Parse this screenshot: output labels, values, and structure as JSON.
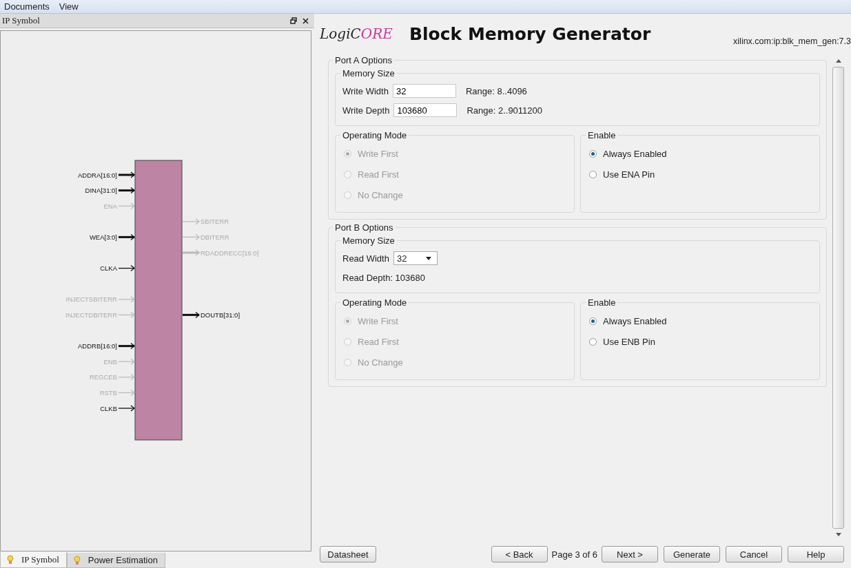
{
  "menu": [
    {
      "label": "Documents"
    },
    {
      "label": "View"
    }
  ],
  "symbol_panel": {
    "title": "IP Symbol",
    "rows": [
      {
        "left": {
          "name": "ADDRA[16:0]",
          "enabled": true,
          "bus": true
        }
      },
      {
        "left": {
          "name": "DINA[31:0]",
          "enabled": true,
          "bus": true
        }
      },
      {
        "left": {
          "name": "ENA",
          "enabled": false,
          "bus": false
        }
      },
      {
        "right": {
          "name": "SBITERR",
          "enabled": false,
          "bus": false
        }
      },
      {
        "left": {
          "name": "WEA[3:0]",
          "enabled": true,
          "bus": true
        },
        "right": {
          "name": "DBITERR",
          "enabled": false,
          "bus": false
        }
      },
      {
        "right": {
          "name": "RDADDRECC[16:0]",
          "enabled": false,
          "bus": true
        }
      },
      {
        "left": {
          "name": "CLKA",
          "enabled": true,
          "bus": false
        }
      },
      {},
      {
        "left": {
          "name": "INJECTSBITERR",
          "enabled": false,
          "bus": false
        }
      },
      {
        "left": {
          "name": "INJECTDBITERR",
          "enabled": false,
          "bus": false
        },
        "right": {
          "name": "DOUTB[31:0]",
          "enabled": true,
          "bus": true
        }
      },
      {},
      {
        "left": {
          "name": "ADDRB[16:0]",
          "enabled": true,
          "bus": true
        }
      },
      {
        "left": {
          "name": "ENB",
          "enabled": false,
          "bus": false
        }
      },
      {
        "left": {
          "name": "REGCEB",
          "enabled": false,
          "bus": false
        }
      },
      {
        "left": {
          "name": "RSTB",
          "enabled": false,
          "bus": false
        }
      },
      {
        "left": {
          "name": "CLKB",
          "enabled": true,
          "bus": false
        }
      }
    ]
  },
  "bottom_tabs": [
    {
      "label": "IP Symbol",
      "selected": true
    },
    {
      "label": "Power Estimation",
      "selected": false
    }
  ],
  "header": {
    "logo": "LogiCORE",
    "title": "Block Memory Generator",
    "ip_id": "xilinx.com:ip:blk_mem_gen:7.3"
  },
  "ports": [
    {
      "title": "Port A Options",
      "memory_size": {
        "title": "Memory Size",
        "fields": [
          {
            "kind": "input",
            "label": "Write Width",
            "value": "32",
            "range": "Range: 8..4096"
          },
          {
            "kind": "input",
            "label": "Write Depth",
            "value": "103680",
            "range": "Range: 2..9011200"
          }
        ]
      },
      "operating_mode": {
        "title": "Operating Mode",
        "options": [
          {
            "label": "Write First",
            "selected": true,
            "disabled": true
          },
          {
            "label": "Read First",
            "selected": false,
            "disabled": true
          },
          {
            "label": "No Change",
            "selected": false,
            "disabled": true
          }
        ]
      },
      "enable": {
        "title": "Enable",
        "options": [
          {
            "label": "Always Enabled",
            "selected": true,
            "disabled": false
          },
          {
            "label": "Use ENA Pin",
            "selected": false,
            "disabled": false
          }
        ]
      }
    },
    {
      "title": "Port B Options",
      "memory_size": {
        "title": "Memory Size",
        "fields": [
          {
            "kind": "dropdown",
            "label": "Read Width",
            "value": "32"
          },
          {
            "kind": "text",
            "label": "Read Depth: 103680"
          }
        ]
      },
      "operating_mode": {
        "title": "Operating Mode",
        "options": [
          {
            "label": "Write First",
            "selected": true,
            "disabled": true
          },
          {
            "label": "Read First",
            "selected": false,
            "disabled": true
          },
          {
            "label": "No Change",
            "selected": false,
            "disabled": true
          }
        ]
      },
      "enable": {
        "title": "Enable",
        "options": [
          {
            "label": "Always Enabled",
            "selected": true,
            "disabled": false
          },
          {
            "label": "Use ENB Pin",
            "selected": false,
            "disabled": false
          }
        ]
      }
    }
  ],
  "footer": {
    "left": [
      {
        "kind": "button",
        "label": "Datasheet"
      }
    ],
    "right": [
      {
        "kind": "button",
        "label": "< Back"
      },
      {
        "kind": "text",
        "label": "Page 3 of 6"
      },
      {
        "kind": "button",
        "label": "Next >"
      },
      {
        "kind": "button",
        "label": "Generate"
      },
      {
        "kind": "button",
        "label": "Cancel"
      },
      {
        "kind": "button",
        "label": "Help"
      }
    ]
  }
}
